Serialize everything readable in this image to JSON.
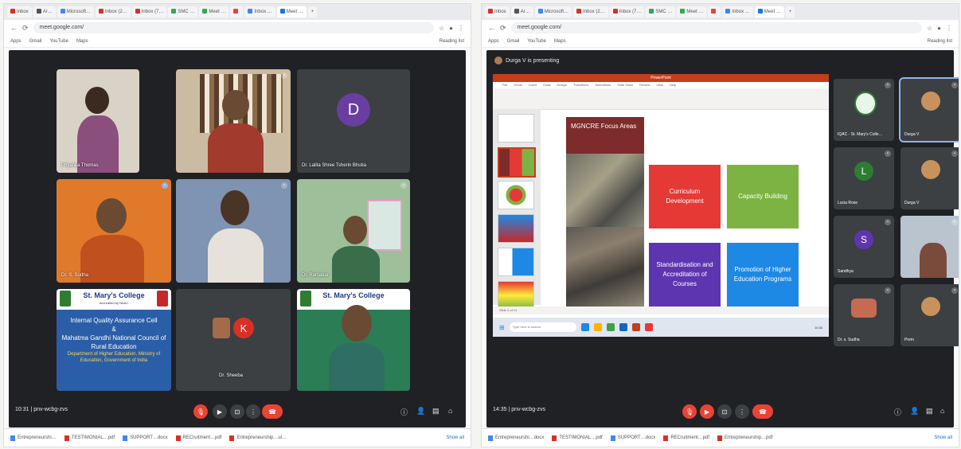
{
  "left": {
    "tabs": [
      {
        "label": "Inbox",
        "color": "#d93025"
      },
      {
        "label": "Ar…",
        "color": "#555555"
      },
      {
        "label": "Microsoft…",
        "color": "#4285f4"
      },
      {
        "label": "Inbox (2…",
        "color": "#d93025"
      },
      {
        "label": "Inbox (7…",
        "color": "#d93025"
      },
      {
        "label": "SMC …",
        "color": "#34a853"
      },
      {
        "label": "Meet …",
        "color": "#34a853"
      },
      {
        "label": "",
        "color": "#ea4335"
      },
      {
        "label": "Inbox …",
        "color": "#4285f4"
      },
      {
        "label": "Meet …",
        "color": "#1a73e8"
      }
    ],
    "url": "meet.google.com/",
    "bookmarks": [
      "Apps",
      "Gmail",
      "YouTube",
      "Maps"
    ],
    "reading_list": "Reading list",
    "participants": [
      {
        "name": "Priyanka Thomas"
      },
      {
        "name": ""
      },
      {
        "name": "Dr. Lalita Shree Tsherin Bhutia",
        "initial": "D",
        "color": "#6a3ea1"
      },
      {
        "name": "Dr. S. Sudha"
      },
      {
        "name": ""
      },
      {
        "name": "Dr. Ratnakar"
      },
      {
        "name": ""
      },
      {
        "name": "Dr. Sheeba",
        "initial": "K",
        "color": "#d93025"
      },
      {
        "name": ""
      }
    ],
    "college_slide": {
      "title": "St. Mary's College",
      "subtitle": "Accredited by NAAC",
      "lines": [
        "Internal Quality Assurance Cell",
        "&",
        "Mahatma Gandhi National Council of",
        "Rural Education"
      ],
      "small": "Department of Higher Education, Ministry of Education, Government of India"
    },
    "time": "10:31 | pnv-wcbg-zvs",
    "downloads": [
      "Entrepreneurshi…",
      "TESTIMONIAL…pdf",
      "SUPPORT…docx",
      "RECruitment…pdf",
      "Entrepreneurship…ui…"
    ],
    "show_all": "Show all"
  },
  "right": {
    "tabs": [
      {
        "label": "Inbox",
        "color": "#d93025"
      },
      {
        "label": "Ar…",
        "color": "#555555"
      },
      {
        "label": "Microsoft…",
        "color": "#4285f4"
      },
      {
        "label": "Inbox (2…",
        "color": "#d93025"
      },
      {
        "label": "Inbox (7…",
        "color": "#d93025"
      },
      {
        "label": "SMC …",
        "color": "#34a853"
      },
      {
        "label": "Meet …",
        "color": "#34a853"
      },
      {
        "label": "",
        "color": "#ea4335"
      },
      {
        "label": "Inbox …",
        "color": "#4285f4"
      },
      {
        "label": "Meet …",
        "color": "#1a73e8"
      }
    ],
    "url": "meet.google.com/",
    "bookmarks": [
      "Apps",
      "Gmail",
      "YouTube",
      "Maps"
    ],
    "reading_list": "Reading list",
    "presenting": "Durga V is presenting",
    "ppt_title": "PowerPoint",
    "ribbon_tabs": [
      "File",
      "Home",
      "Insert",
      "Draw",
      "Design",
      "Transitions",
      "Animations",
      "Slide Show",
      "Review",
      "View",
      "Help"
    ],
    "slide": {
      "focus_title": "MGNCRE Focus Areas",
      "boxes": [
        {
          "text": "Curriculum Development",
          "color": "#e53935"
        },
        {
          "text": "Capacity Building",
          "color": "#7cb342"
        },
        {
          "text": "Standardisation and Accreditation of Courses",
          "color": "#5e35b1"
        },
        {
          "text": "Promotion of Higher Education Programs",
          "color": "#1e88e5"
        }
      ]
    },
    "status": "Slide 4 of 14",
    "taskbar_search": "Type here to search",
    "clock": "10:35",
    "side_participants": [
      {
        "name": "IQAC - St. Mary's Colle…"
      },
      {
        "name": "Durga V"
      },
      {
        "name": "Lucia Rose",
        "initial": "L",
        "color": "#2e7d32"
      },
      {
        "name": "Durga V"
      },
      {
        "name": "Sandhya",
        "initial": "S",
        "color": "#5e35b1"
      },
      {
        "name": ""
      },
      {
        "name": "Dr. s. Sudha"
      },
      {
        "name": "Prem"
      }
    ],
    "time": "14:35 | pnv-wcbg-zvs",
    "downloads": [
      "Entrepreneurshi…docx",
      "TESTIMONIAL…pdf",
      "SUPPORT…docx",
      "RECruitment…pdf",
      "Entrepreneurship…pdf"
    ],
    "show_all": "Show all"
  }
}
